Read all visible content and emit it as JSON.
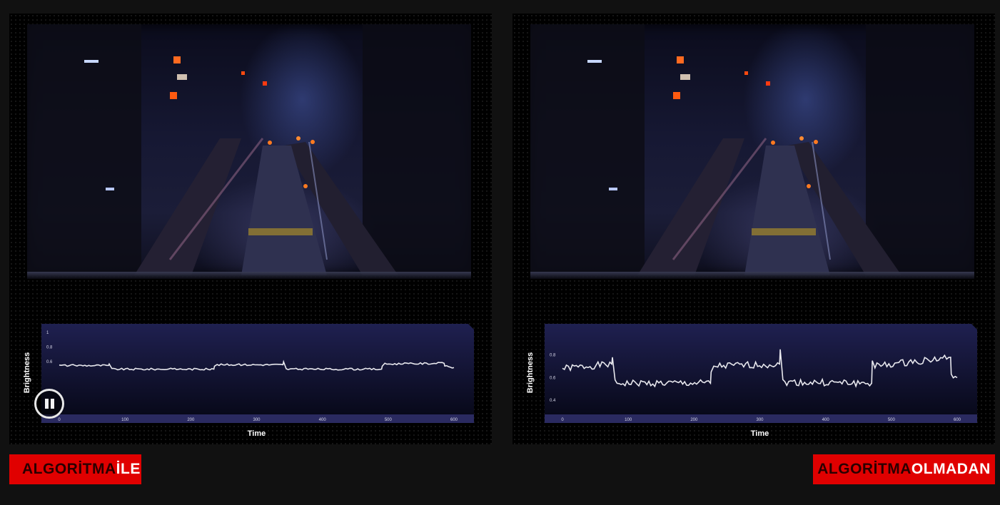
{
  "labels": {
    "left": {
      "part1": "ALGORİTMA",
      "part2": "İLE"
    },
    "right": {
      "part1": "ALGORİTMA",
      "part2": "OLMADAN"
    }
  },
  "icons": {
    "pause": "pause-icon"
  },
  "colors": {
    "accent_red": "#e00000",
    "background": "#111111",
    "line": "#e8e8ee"
  },
  "chart_data": [
    {
      "type": "line",
      "title": "",
      "xlabel": "Time",
      "ylabel": "Brightness",
      "xlim": [
        0,
        600
      ],
      "ylim": [
        0,
        1
      ],
      "xticks": [
        0,
        100,
        200,
        300,
        400,
        500,
        600
      ],
      "yticks": [
        1,
        0.8,
        0.6
      ],
      "series": [
        {
          "values_x": [
            0,
            75,
            76,
            80,
            235,
            236,
            240,
            340,
            341,
            345,
            490,
            491,
            495,
            585,
            586,
            600
          ],
          "values_y": [
            0.55,
            0.55,
            0.57,
            0.5,
            0.5,
            0.54,
            0.56,
            0.56,
            0.6,
            0.5,
            0.5,
            0.54,
            0.57,
            0.58,
            0.55,
            0.52
          ]
        }
      ]
    },
    {
      "type": "line",
      "title": "",
      "xlabel": "Time",
      "ylabel": "Brightness",
      "xlim": [
        0,
        600
      ],
      "ylim": [
        0.35,
        1.0
      ],
      "xticks": [
        0,
        100,
        200,
        300,
        400,
        500,
        600
      ],
      "yticks": [
        0.8,
        0.6,
        0.4
      ],
      "series": [
        {
          "values_x": [
            0,
            75,
            76,
            80,
            225,
            226,
            230,
            330,
            331,
            335,
            470,
            471,
            475,
            590,
            591,
            600
          ],
          "values_y": [
            0.68,
            0.72,
            0.78,
            0.55,
            0.55,
            0.65,
            0.7,
            0.72,
            0.85,
            0.56,
            0.55,
            0.75,
            0.7,
            0.78,
            0.62,
            0.6
          ]
        }
      ]
    }
  ]
}
